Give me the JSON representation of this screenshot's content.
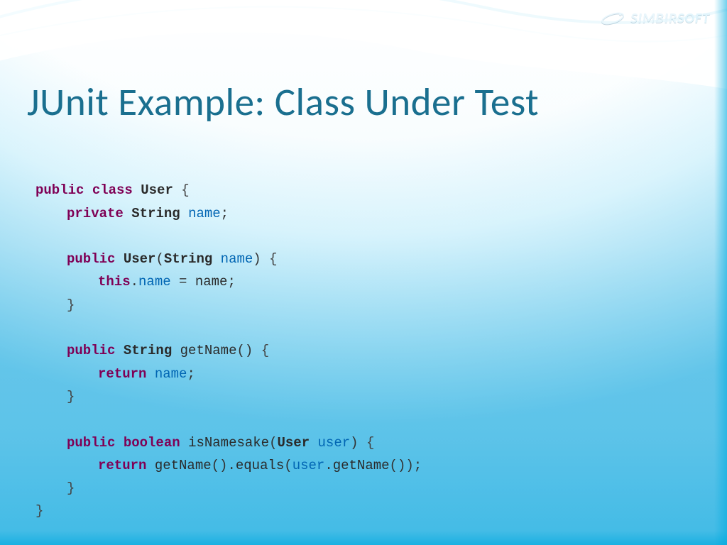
{
  "brand": {
    "name1": "SIMBIR",
    "name2": "SOFT"
  },
  "title": "JUnit Example: Class Under Test",
  "code": {
    "l01": {
      "kw1": "public",
      "kw2": "class",
      "cls": "User",
      "open": "{"
    },
    "l02": {
      "kw1": "private",
      "type": "String",
      "field": "name",
      "end": ";"
    },
    "l03": {
      "kw1": "public",
      "cls": "User",
      "lp": "(",
      "ptype": "String",
      "pname": "name",
      "rp": ")",
      "open": "{"
    },
    "l04": {
      "kw1": "this",
      "dot": ".",
      "field": "name",
      "eq": " = ",
      "rhs": "name",
      "end": ";"
    },
    "l05": {
      "close": "}"
    },
    "l06": {
      "kw1": "public",
      "type": "String",
      "method": "getName",
      "parens": "()",
      "open": "{"
    },
    "l07": {
      "kw1": "return",
      "field": "name",
      "end": ";"
    },
    "l08": {
      "close": "}"
    },
    "l09": {
      "kw1": "public",
      "kw2": "boolean",
      "method": "isNamesake",
      "lp": "(",
      "ptype": "User",
      "pname": "user",
      "rp": ")",
      "open": "{"
    },
    "l10": {
      "kw1": "return",
      "call1": "getName",
      "p1": "()",
      "dot1": ".",
      "call2": "equals",
      "lp": "(",
      "arg": "user",
      "dot2": ".",
      "call3": "getName",
      "p3": "()",
      "rp": ")",
      "end": ";"
    },
    "l11": {
      "close": "}"
    },
    "l12": {
      "close": "}"
    }
  }
}
